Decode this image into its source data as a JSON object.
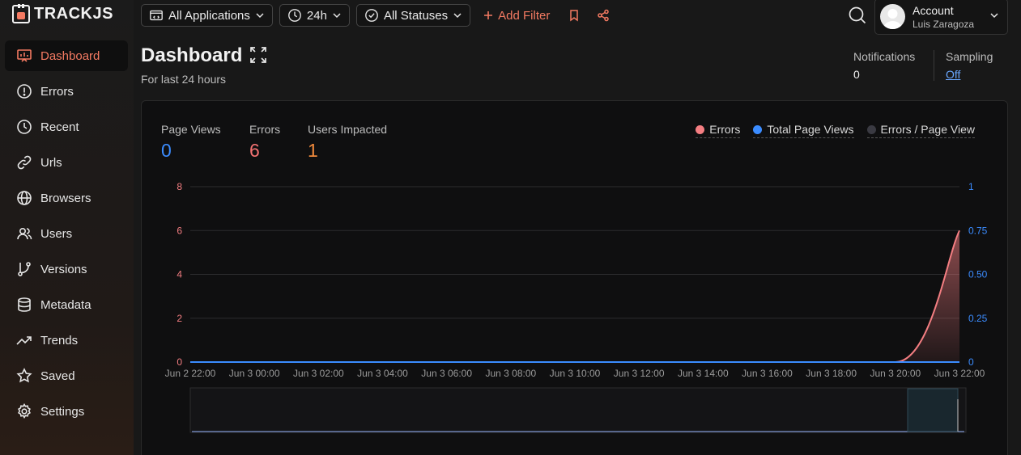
{
  "brand": {
    "name": "TRACKJS"
  },
  "nav": [
    {
      "label": "Dashboard",
      "icon": "dashboard-icon",
      "active": true
    },
    {
      "label": "Errors",
      "icon": "alert-circle-icon"
    },
    {
      "label": "Recent",
      "icon": "clock-icon"
    },
    {
      "label": "Urls",
      "icon": "link-icon"
    },
    {
      "label": "Browsers",
      "icon": "globe-icon"
    },
    {
      "label": "Users",
      "icon": "users-icon"
    },
    {
      "label": "Versions",
      "icon": "git-branch-icon"
    },
    {
      "label": "Metadata",
      "icon": "database-icon"
    },
    {
      "label": "Trends",
      "icon": "trending-up-icon"
    },
    {
      "label": "Saved",
      "icon": "star-icon"
    },
    {
      "label": "Settings",
      "icon": "gear-icon"
    }
  ],
  "toolbar": {
    "applications": "All Applications",
    "timerange": "24h",
    "statuses": "All Statuses",
    "add_filter": "Add Filter"
  },
  "account": {
    "title": "Account",
    "user": "Luis Zaragoza"
  },
  "page": {
    "title": "Dashboard",
    "subtitle": "For last 24 hours"
  },
  "notifications": {
    "label": "Notifications",
    "value": "0"
  },
  "sampling": {
    "label": "Sampling",
    "value": "Off"
  },
  "stats": [
    {
      "label": "Page Views",
      "value": "0",
      "color": "#3b8cff"
    },
    {
      "label": "Errors",
      "value": "6",
      "color": "#f47272"
    },
    {
      "label": "Users Impacted",
      "value": "1",
      "color": "#f08a3c"
    }
  ],
  "legend": [
    {
      "label": "Errors",
      "color": "#f47e82"
    },
    {
      "label": "Total Page Views",
      "color": "#3b8cff"
    },
    {
      "label": "Errors / Page View",
      "color": "#3a3a42"
    }
  ],
  "colors": {
    "accent": "#f47a62",
    "errors": "#f47e82",
    "pageviews": "#3b8cff"
  },
  "chart_data": {
    "type": "area",
    "x": [
      "Jun 2 22:00",
      "Jun 3 00:00",
      "Jun 3 02:00",
      "Jun 3 04:00",
      "Jun 3 06:00",
      "Jun 3 08:00",
      "Jun 3 10:00",
      "Jun 3 12:00",
      "Jun 3 14:00",
      "Jun 3 16:00",
      "Jun 3 18:00",
      "Jun 3 20:00",
      "Jun 3 22:00"
    ],
    "series": [
      {
        "name": "Errors",
        "axis": "left",
        "values": [
          0,
          0,
          0,
          0,
          0,
          0,
          0,
          0,
          0,
          0,
          0,
          0,
          6
        ]
      },
      {
        "name": "Total Page Views",
        "axis": "right",
        "values": [
          0,
          0,
          0,
          0,
          0,
          0,
          0,
          0,
          0,
          0,
          0,
          0,
          0
        ]
      }
    ],
    "y_left_ticks": [
      "0",
      "2",
      "4",
      "6",
      "8"
    ],
    "y_right_ticks": [
      "0",
      "0.25",
      "0.50",
      "0.75",
      "1"
    ],
    "ylim_left": [
      0,
      8
    ],
    "ylim_right": [
      0,
      1
    ],
    "grid": true
  }
}
